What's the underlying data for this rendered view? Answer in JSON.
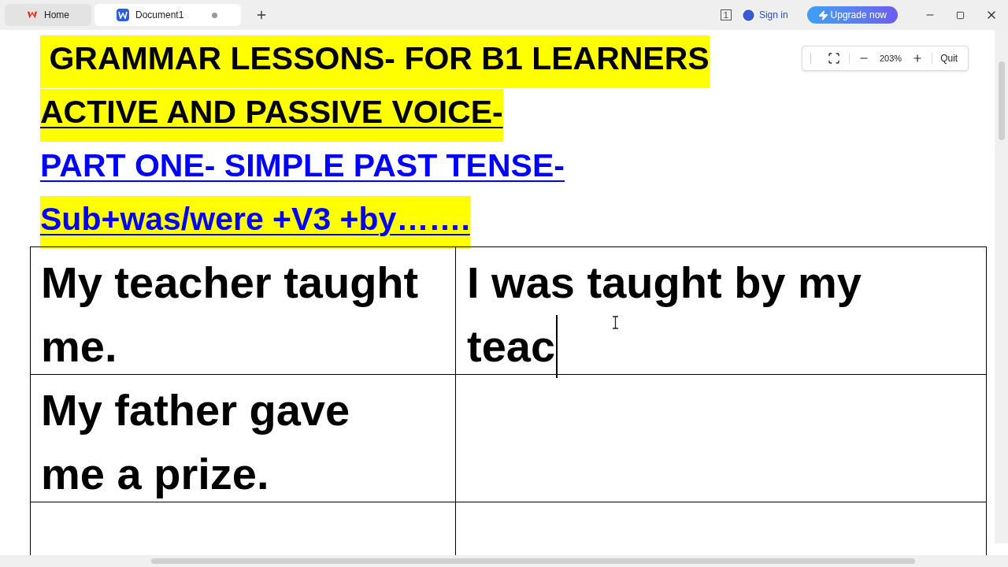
{
  "tabs": [
    {
      "label": "Home",
      "kind": "home",
      "selected": false
    },
    {
      "label": "Document1",
      "kind": "document",
      "selected": true,
      "unsaved": true
    }
  ],
  "header": {
    "page_count": "1",
    "sign_in": "Sign in",
    "upgrade": "Upgrade now"
  },
  "zoom_bar": {
    "zoom": "203%",
    "quit": "Quit"
  },
  "headings": [
    {
      "text": " GRAMMAR LESSONS- FOR B1 LEARNERS",
      "color": "#000000",
      "highlight": true,
      "underline": false
    },
    {
      "text": "ACTIVE AND PASSIVE VOICE-",
      "color": "#000000",
      "highlight": true,
      "underline": true
    },
    {
      "text": "PART ONE- SIMPLE PAST TENSE-",
      "color": "#0000ff",
      "highlight": false,
      "underline": true
    },
    {
      "text": "Sub+was/were +V3 +by…….",
      "color": "#0000ff",
      "highlight": true,
      "underline": true
    }
  ],
  "table": {
    "rows": [
      {
        "column_1": "My teacher taught me.",
        "column_2": "I was taught by my teac",
        "caret": true
      },
      {
        "column_1": "My father gave me a prize.",
        "caret": false
      },
      {
        "caret": false
      }
    ]
  }
}
